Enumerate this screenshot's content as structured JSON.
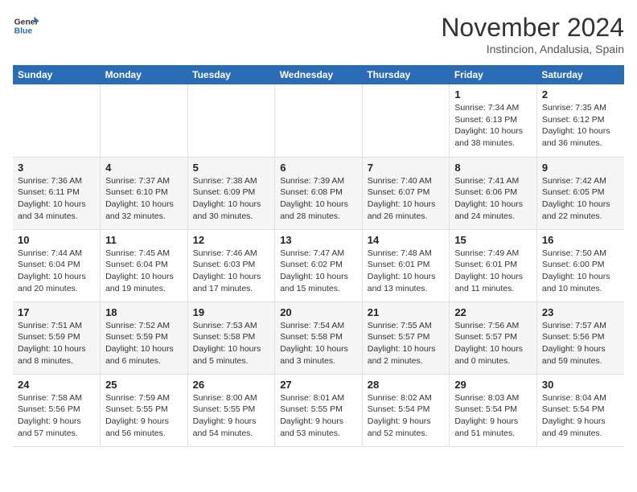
{
  "logo": {
    "line1": "General",
    "line2": "Blue"
  },
  "title": "November 2024",
  "subtitle": "Instincion, Andalusia, Spain",
  "headers": [
    "Sunday",
    "Monday",
    "Tuesday",
    "Wednesday",
    "Thursday",
    "Friday",
    "Saturday"
  ],
  "weeks": [
    {
      "days": [
        {
          "num": "",
          "info": ""
        },
        {
          "num": "",
          "info": ""
        },
        {
          "num": "",
          "info": ""
        },
        {
          "num": "",
          "info": ""
        },
        {
          "num": "",
          "info": ""
        },
        {
          "num": "1",
          "info": "Sunrise: 7:34 AM\nSunset: 6:13 PM\nDaylight: 10 hours\nand 38 minutes."
        },
        {
          "num": "2",
          "info": "Sunrise: 7:35 AM\nSunset: 6:12 PM\nDaylight: 10 hours\nand 36 minutes."
        }
      ]
    },
    {
      "days": [
        {
          "num": "3",
          "info": "Sunrise: 7:36 AM\nSunset: 6:11 PM\nDaylight: 10 hours\nand 34 minutes."
        },
        {
          "num": "4",
          "info": "Sunrise: 7:37 AM\nSunset: 6:10 PM\nDaylight: 10 hours\nand 32 minutes."
        },
        {
          "num": "5",
          "info": "Sunrise: 7:38 AM\nSunset: 6:09 PM\nDaylight: 10 hours\nand 30 minutes."
        },
        {
          "num": "6",
          "info": "Sunrise: 7:39 AM\nSunset: 6:08 PM\nDaylight: 10 hours\nand 28 minutes."
        },
        {
          "num": "7",
          "info": "Sunrise: 7:40 AM\nSunset: 6:07 PM\nDaylight: 10 hours\nand 26 minutes."
        },
        {
          "num": "8",
          "info": "Sunrise: 7:41 AM\nSunset: 6:06 PM\nDaylight: 10 hours\nand 24 minutes."
        },
        {
          "num": "9",
          "info": "Sunrise: 7:42 AM\nSunset: 6:05 PM\nDaylight: 10 hours\nand 22 minutes."
        }
      ]
    },
    {
      "days": [
        {
          "num": "10",
          "info": "Sunrise: 7:44 AM\nSunset: 6:04 PM\nDaylight: 10 hours\nand 20 minutes."
        },
        {
          "num": "11",
          "info": "Sunrise: 7:45 AM\nSunset: 6:04 PM\nDaylight: 10 hours\nand 19 minutes."
        },
        {
          "num": "12",
          "info": "Sunrise: 7:46 AM\nSunset: 6:03 PM\nDaylight: 10 hours\nand 17 minutes."
        },
        {
          "num": "13",
          "info": "Sunrise: 7:47 AM\nSunset: 6:02 PM\nDaylight: 10 hours\nand 15 minutes."
        },
        {
          "num": "14",
          "info": "Sunrise: 7:48 AM\nSunset: 6:01 PM\nDaylight: 10 hours\nand 13 minutes."
        },
        {
          "num": "15",
          "info": "Sunrise: 7:49 AM\nSunset: 6:01 PM\nDaylight: 10 hours\nand 11 minutes."
        },
        {
          "num": "16",
          "info": "Sunrise: 7:50 AM\nSunset: 6:00 PM\nDaylight: 10 hours\nand 10 minutes."
        }
      ]
    },
    {
      "days": [
        {
          "num": "17",
          "info": "Sunrise: 7:51 AM\nSunset: 5:59 PM\nDaylight: 10 hours\nand 8 minutes."
        },
        {
          "num": "18",
          "info": "Sunrise: 7:52 AM\nSunset: 5:59 PM\nDaylight: 10 hours\nand 6 minutes."
        },
        {
          "num": "19",
          "info": "Sunrise: 7:53 AM\nSunset: 5:58 PM\nDaylight: 10 hours\nand 5 minutes."
        },
        {
          "num": "20",
          "info": "Sunrise: 7:54 AM\nSunset: 5:58 PM\nDaylight: 10 hours\nand 3 minutes."
        },
        {
          "num": "21",
          "info": "Sunrise: 7:55 AM\nSunset: 5:57 PM\nDaylight: 10 hours\nand 2 minutes."
        },
        {
          "num": "22",
          "info": "Sunrise: 7:56 AM\nSunset: 5:57 PM\nDaylight: 10 hours\nand 0 minutes."
        },
        {
          "num": "23",
          "info": "Sunrise: 7:57 AM\nSunset: 5:56 PM\nDaylight: 9 hours\nand 59 minutes."
        }
      ]
    },
    {
      "days": [
        {
          "num": "24",
          "info": "Sunrise: 7:58 AM\nSunset: 5:56 PM\nDaylight: 9 hours\nand 57 minutes."
        },
        {
          "num": "25",
          "info": "Sunrise: 7:59 AM\nSunset: 5:55 PM\nDaylight: 9 hours\nand 56 minutes."
        },
        {
          "num": "26",
          "info": "Sunrise: 8:00 AM\nSunset: 5:55 PM\nDaylight: 9 hours\nand 54 minutes."
        },
        {
          "num": "27",
          "info": "Sunrise: 8:01 AM\nSunset: 5:55 PM\nDaylight: 9 hours\nand 53 minutes."
        },
        {
          "num": "28",
          "info": "Sunrise: 8:02 AM\nSunset: 5:54 PM\nDaylight: 9 hours\nand 52 minutes."
        },
        {
          "num": "29",
          "info": "Sunrise: 8:03 AM\nSunset: 5:54 PM\nDaylight: 9 hours\nand 51 minutes."
        },
        {
          "num": "30",
          "info": "Sunrise: 8:04 AM\nSunset: 5:54 PM\nDaylight: 9 hours\nand 49 minutes."
        }
      ]
    }
  ]
}
